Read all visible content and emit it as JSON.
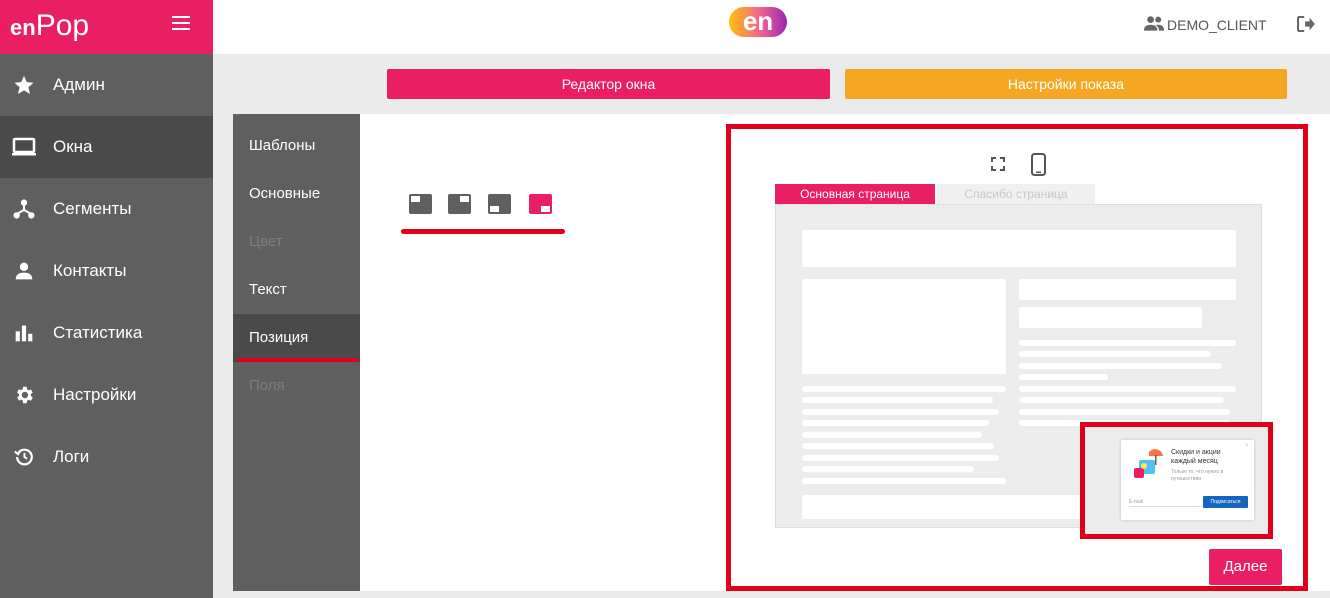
{
  "brand": {
    "logo_bold": "en",
    "logo_rest": "Pop"
  },
  "header": {
    "center_logo": "en",
    "user": "DEMO_CLIENT"
  },
  "sidebar": {
    "items": [
      {
        "label": "Админ",
        "icon": "star-icon",
        "active": false
      },
      {
        "label": "Окна",
        "icon": "monitor-icon",
        "active": true
      },
      {
        "label": "Сегменты",
        "icon": "segments-icon",
        "active": false
      },
      {
        "label": "Контакты",
        "icon": "person-icon",
        "active": false
      },
      {
        "label": "Статистика",
        "icon": "bar-chart-icon",
        "active": false
      },
      {
        "label": "Настройки",
        "icon": "gear-icon",
        "active": false
      },
      {
        "label": "Логи",
        "icon": "history-icon",
        "active": false
      }
    ]
  },
  "toolbar": {
    "editor_label": "Редактор окна",
    "show_settings_label": "Настройки показа"
  },
  "subnav": {
    "items": [
      {
        "label": "Шаблоны",
        "state": "normal"
      },
      {
        "label": "Основные",
        "state": "normal"
      },
      {
        "label": "Цвет",
        "state": "disabled"
      },
      {
        "label": "Текст",
        "state": "normal"
      },
      {
        "label": "Позиция",
        "state": "active"
      },
      {
        "label": "Поля",
        "state": "disabled"
      }
    ]
  },
  "positions": {
    "options": [
      "top-left",
      "top-right",
      "bottom-right",
      "bottom-right-selected"
    ],
    "selected_index": 3
  },
  "preview": {
    "tabs": [
      "Основная страница",
      "Спасибо страница"
    ],
    "popup": {
      "title": "Скидки и акции каждый месяц",
      "subtitle": "Только то, что нужно в путешествии",
      "email_placeholder": "E-mail",
      "subscribe_label": "Подписаться",
      "close": "×"
    }
  },
  "next_button": "Далее",
  "colors": {
    "brand_pink": "#e91e63",
    "sidebar_gray": "#5f5f5f",
    "accent_orange": "#f5a623",
    "highlight_red": "#e0001b"
  }
}
